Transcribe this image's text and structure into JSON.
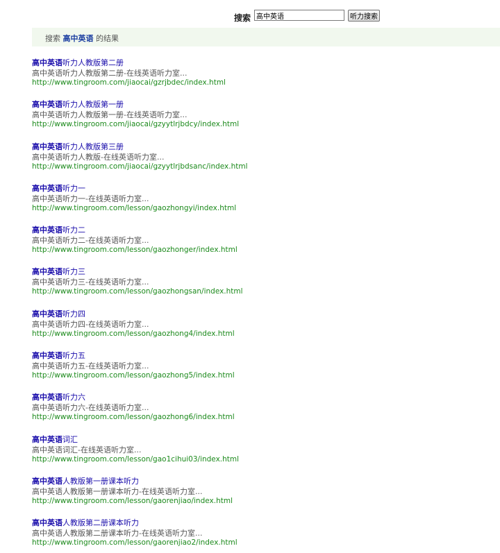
{
  "search": {
    "label": "搜索",
    "query": "高中英语",
    "button_label": "听力搜索"
  },
  "header": {
    "prefix": "搜索",
    "keyword": "高中英语",
    "suffix": "的结果"
  },
  "results": [
    {
      "keyword": "高中英语",
      "title_rest": "听力人教版第二册",
      "desc": "高中英语听力人教版第二册-在线英语听力室...",
      "url": "http://www.tingroom.com/jiaocai/gzrjbdec/index.html"
    },
    {
      "keyword": "高中英语",
      "title_rest": "听力人教版第一册",
      "desc": "高中英语听力人教版第一册-在线英语听力室...",
      "url": "http://www.tingroom.com/jiaocai/gzyytlrjbdcy/index.html"
    },
    {
      "keyword": "高中英语",
      "title_rest": "听力人教版第三册",
      "desc": "高中英语听力人教版-在线英语听力室...",
      "url": "http://www.tingroom.com/jiaocai/gzyytlrjbdsanc/index.html"
    },
    {
      "keyword": "高中英语",
      "title_rest": "听力一",
      "desc": "高中英语听力一-在线英语听力室...",
      "url": "http://www.tingroom.com/lesson/gaozhongyi/index.html"
    },
    {
      "keyword": "高中英语",
      "title_rest": "听力二",
      "desc": "高中英语听力二-在线英语听力室...",
      "url": "http://www.tingroom.com/lesson/gaozhonger/index.html"
    },
    {
      "keyword": "高中英语",
      "title_rest": "听力三",
      "desc": "高中英语听力三-在线英语听力室...",
      "url": "http://www.tingroom.com/lesson/gaozhongsan/index.html"
    },
    {
      "keyword": "高中英语",
      "title_rest": "听力四",
      "desc": "高中英语听力四-在线英语听力室...",
      "url": "http://www.tingroom.com/lesson/gaozhong4/index.html"
    },
    {
      "keyword": "高中英语",
      "title_rest": "听力五",
      "desc": "高中英语听力五-在线英语听力室...",
      "url": "http://www.tingroom.com/lesson/gaozhong5/index.html"
    },
    {
      "keyword": "高中英语",
      "title_rest": "听力六",
      "desc": "高中英语听力六-在线英语听力室...",
      "url": "http://www.tingroom.com/lesson/gaozhong6/index.html"
    },
    {
      "keyword": "高中英语",
      "title_rest": "词汇",
      "desc": "高中英语词汇-在线英语听力室...",
      "url": "http://www.tingroom.com/lesson/gao1cihui03/index.html"
    },
    {
      "keyword": "高中英语",
      "title_rest": "人教版第一册课本听力",
      "desc": "高中英语人教版第一册课本听力-在线英语听力室...",
      "url": "http://www.tingroom.com/lesson/gaorenjiao/index.html"
    },
    {
      "keyword": "高中英语",
      "title_rest": "人教版第二册课本听力",
      "desc": "高中英语人教版第二册课本听力-在线英语听力室...",
      "url": "http://www.tingroom.com/lesson/gaorenjiao2/index.html"
    }
  ]
}
